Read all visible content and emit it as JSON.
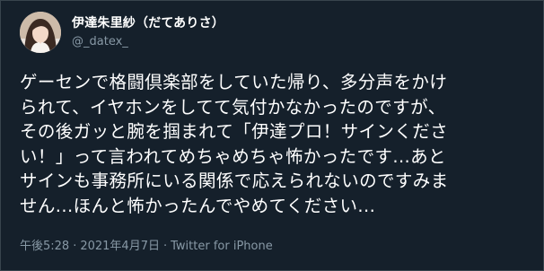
{
  "user": {
    "display_name": "伊達朱里紗（だてありさ）",
    "handle": "@_datex_",
    "avatar_icon": "profile-photo"
  },
  "tweet": {
    "text_lines": [
      "ゲーセンで格闘倶楽部をしていた帰り、多分声をかけ",
      "られて、イヤホンをしてて気付かなかったのですが、",
      "その後ガッと腕を掴まれて「伊達プロ！サインくださ",
      "い！」って言われてめちゃめちゃ怖かったです...あと",
      "サインも事務所にいる関係で応えられないのですみま",
      "せん...ほんと怖かったんでやめてください..."
    ],
    "time": "午後5:28",
    "date": "2021年4月7日",
    "separator": "·",
    "source": "Twitter for iPhone"
  },
  "colors": {
    "background": "#15202b",
    "text": "#ffffff",
    "secondary": "#8899a6"
  }
}
